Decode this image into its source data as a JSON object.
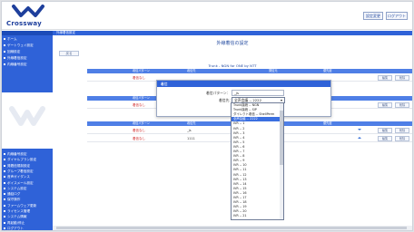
{
  "brand": {
    "name": "Crossway",
    "color": "#1e3f9c",
    "icon": "crossway-logo-icon"
  },
  "header": {
    "settings_label": "設定変更",
    "logout_label": "ログアウト"
  },
  "sidebar": {
    "top_items": [
      "ホーム",
      "ゲートウェイ設定",
      "回線設定",
      "外線着信設定",
      "内線番号設定"
    ],
    "bottom_items": [
      "内線番号設定",
      "ダイヤルプラン設定",
      "発着信規制設定",
      "グループ着信設定",
      "音声ガイダンス",
      "ボイスメール設定",
      "システム設定",
      "通話ログ",
      "保守操作",
      "ファームウェア更新",
      "ライセンス管理",
      "システム情報",
      "再起動/停止",
      "ログアウト"
    ]
  },
  "main": {
    "breadcrumb": "外線着信設定",
    "page_title": "外線着信の設定",
    "back_label": "戻る",
    "section1_title": "Trunk - NGN for ONE by NTT",
    "section2_title": "Trunk - Vo IP",
    "table_headers": [
      "着信パターン",
      "着信先",
      "発信元",
      "優先度"
    ],
    "edit_label": "編集",
    "delete_label": "削除",
    "rows": [
      {
        "pattern": "着信なし",
        "target": "",
        "extra": ""
      },
      {
        "pattern": "着信なし",
        "target": "",
        "extra": ""
      },
      {
        "pattern": "着信なし",
        "target": "_js",
        "extra": ""
      },
      {
        "pattern": "着信なし",
        "target": "1111",
        "extra": ""
      }
    ]
  },
  "dialog": {
    "title": "着信",
    "close_label": "×",
    "pattern_label": "着信パターン：",
    "pattern_value": "_js",
    "target_label": "着信先：",
    "target_value": "全声会議 -- 2222"
  },
  "dropdown": {
    "options": [
      "Trunk接続 -- NGN",
      "Trunk接続 -- SIP",
      "ダイレクト着信 -- ShellPerm",
      "全声会議 -- 2222",
      "IVR -- 1",
      "IVR -- 2",
      "IVR -- 3",
      "IVR -- 4",
      "IVR -- 5",
      "IVR -- 6",
      "IVR -- 7",
      "IVR -- 8",
      "IVR -- 9",
      "IVR -- 10",
      "IVR -- 11",
      "IVR -- 12",
      "IVR -- 13",
      "IVR -- 14",
      "IVR -- 15",
      "IVR -- 16",
      "IVR -- 17",
      "IVR -- 18",
      "IVR -- 19",
      "IVR -- 20",
      "IVR -- 21"
    ],
    "selected_index": 3
  },
  "colors": {
    "accent": "#2f62d8",
    "table_head": "#4f7fe6",
    "alert": "#d02b2b"
  }
}
